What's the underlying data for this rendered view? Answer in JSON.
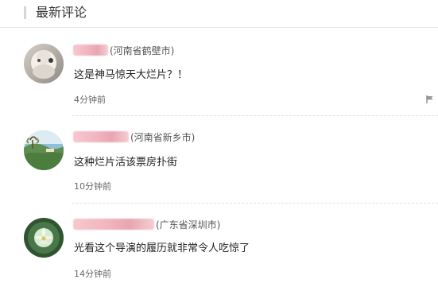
{
  "section_title": "最新评论",
  "comments": [
    {
      "location": "(河南省鹤壁市)",
      "text": "这是神马惊天大烂片？！",
      "time": "4分钟前",
      "avatar_icon": "portrait-avatar-icon"
    },
    {
      "location": "(河南省新乡市)",
      "text": "这种烂片活该票房扑街",
      "time": "10分钟前",
      "avatar_icon": "landscape-avatar-icon"
    },
    {
      "location": "(广东省深圳市)",
      "text": "光看这个导演的履历就非常令人吃惊了",
      "time": "14分钟前",
      "avatar_icon": "lotus-avatar-icon"
    }
  ],
  "actions": {
    "report_icon": "flag-icon"
  },
  "colors": {
    "separator": "#e2e2e2",
    "header_accent": "#d6d6d6",
    "text_primary": "#222222",
    "text_secondary": "#666666",
    "blur_name": "#f1b6c0"
  }
}
